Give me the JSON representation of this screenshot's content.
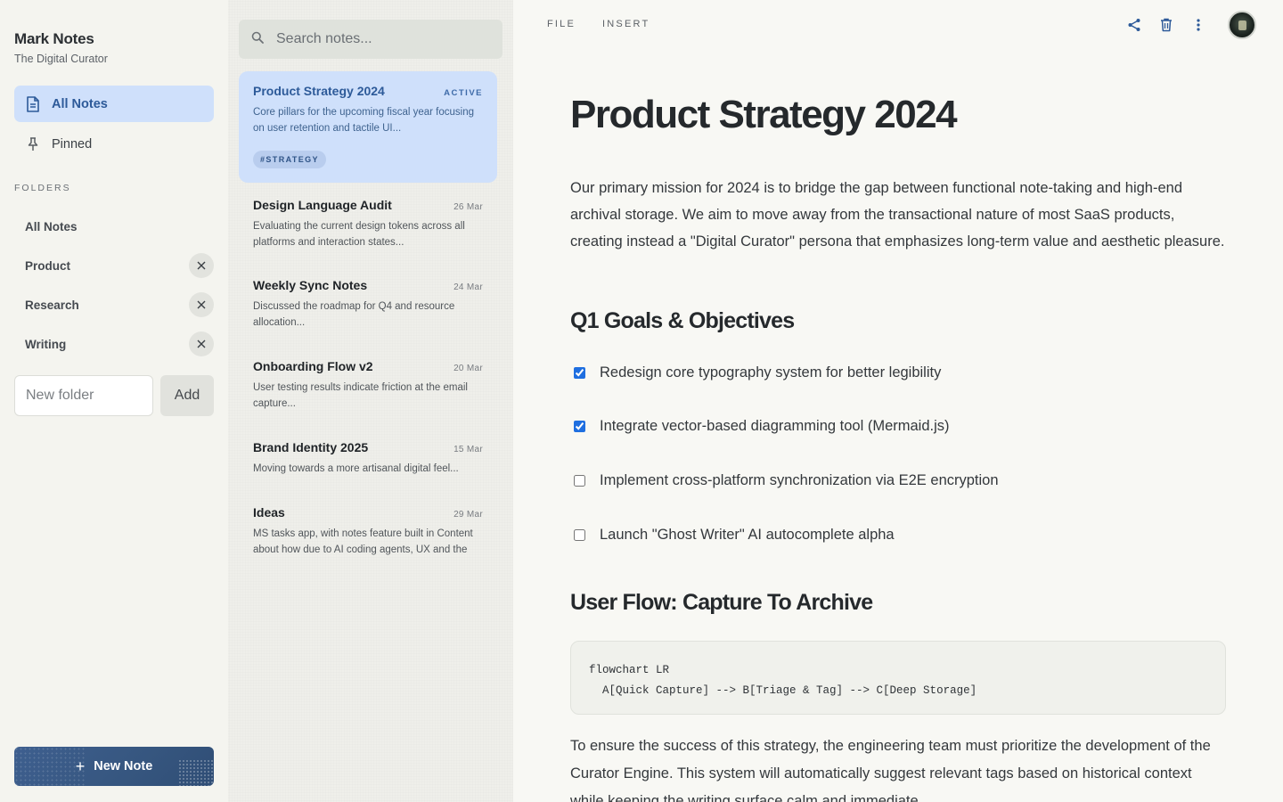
{
  "app": {
    "title": "Mark Notes",
    "subtitle": "The Digital Curator"
  },
  "nav": {
    "all_notes": "All Notes",
    "pinned": "Pinned"
  },
  "folders": {
    "label": "FOLDERS",
    "items": [
      {
        "name": "All Notes",
        "removable": false
      },
      {
        "name": "Product",
        "removable": true
      },
      {
        "name": "Research",
        "removable": true
      },
      {
        "name": "Writing",
        "removable": true
      }
    ],
    "new_placeholder": "New folder",
    "add_label": "Add"
  },
  "new_note": {
    "label": "New Note",
    "icon": "plus-icon"
  },
  "search": {
    "placeholder": "Search notes..."
  },
  "notes": [
    {
      "title": "Product Strategy 2024",
      "status": "ACTIVE",
      "excerpt": "Core pillars for the upcoming fiscal year focusing on user retention and tactile UI...",
      "tag": "#STRATEGY"
    },
    {
      "title": "Design Language Audit",
      "date": "26 Mar",
      "excerpt": "Evaluating the current design tokens across all platforms and interaction states..."
    },
    {
      "title": "Weekly Sync Notes",
      "date": "24 Mar",
      "excerpt": "Discussed the roadmap for Q4 and resource allocation..."
    },
    {
      "title": "Onboarding Flow v2",
      "date": "20 Mar",
      "excerpt": "User testing results indicate friction at the email capture..."
    },
    {
      "title": "Brand Identity 2025",
      "date": "15 Mar",
      "excerpt": "Moving towards a more artisanal digital feel..."
    },
    {
      "title": "Ideas",
      "date": "29 Mar",
      "excerpt": "MS tasks app, with notes feature built in Content about how due to AI coding agents, UX and the"
    }
  ],
  "menu": {
    "file": "FILE",
    "insert": "INSERT"
  },
  "toolbar_icons": [
    "share-icon",
    "trash-icon",
    "more-vertical-icon"
  ],
  "document": {
    "title": "Product Strategy 2024",
    "intro": "Our primary mission for 2024 is to bridge the gap between functional note-taking and high-end archival storage. We aim to move away from the transactional nature of most SaaS products, creating instead a \"Digital Curator\" persona that emphasizes long-term value and aesthetic pleasure.",
    "h2_goals": "Q1 Goals & Objectives",
    "tasks": [
      {
        "text": "Redesign core typography system for better legibility",
        "done": true
      },
      {
        "text": "Integrate vector-based diagramming tool (Mermaid.js)",
        "done": true
      },
      {
        "text": "Implement cross-platform synchronization via E2E encryption",
        "done": false
      },
      {
        "text": "Launch \"Ghost Writer\" AI autocomplete alpha",
        "done": false
      }
    ],
    "h2_flow": "User Flow: Capture To Archive",
    "code": "flowchart LR\n  A[Quick Capture] --> B[Triage & Tag] --> C[Deep Storage]",
    "outro": "To ensure the success of this strategy, the engineering team must prioritize the development of the Curator Engine. This system will automatically suggest relevant tags based on historical context while keeping the writing surface calm and immediate."
  },
  "colors": {
    "accent": "#2d5a99",
    "active_bg": "#cfe0fb",
    "primary_button": "#3a5a88",
    "checkbox": "#1f6fe0"
  }
}
